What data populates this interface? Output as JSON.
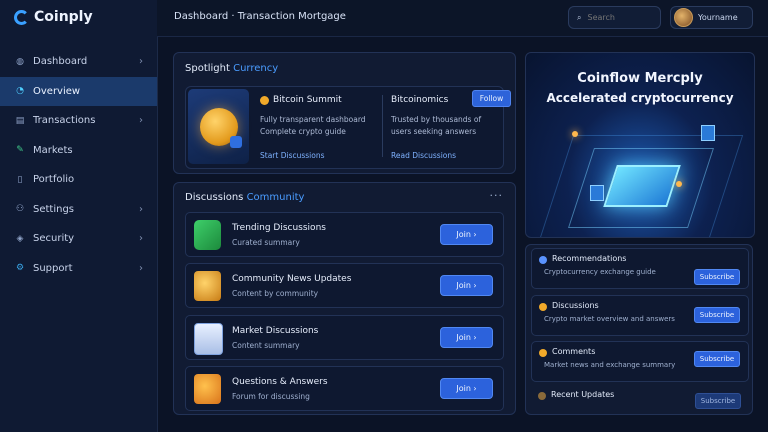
{
  "app": {
    "name": "Coinply"
  },
  "sidebar": {
    "items": [
      {
        "label": "Dashboard",
        "icon": "globe-icon",
        "active": false
      },
      {
        "label": "Overview",
        "icon": "pie-icon",
        "active": true
      },
      {
        "label": "Transactions",
        "icon": "list-icon",
        "active": false
      },
      {
        "label": "Markets",
        "icon": "pen-icon",
        "active": false
      },
      {
        "label": "Portfolio",
        "icon": "document-icon",
        "active": false
      },
      {
        "label": "Settings",
        "icon": "person-icon",
        "active": false
      },
      {
        "label": "Security",
        "icon": "shield-icon",
        "active": false
      },
      {
        "label": "Support",
        "icon": "gear-icon",
        "active": false
      }
    ]
  },
  "topbar": {
    "title": "Dashboard · Transaction Mortgage",
    "search_placeholder": "Search",
    "user_name": "Yourname"
  },
  "featured": {
    "title": "Spotlight",
    "title_accent": "Currency",
    "coin_name": "Bitcoin Summit",
    "line1": "Fully transparent dashboard",
    "line2": "Complete crypto guide",
    "link": "Start Discussions",
    "stat_title": "Bitcoinomics",
    "stat_line1": "Trusted by thousands of",
    "stat_line2": "users seeking answers",
    "stat_link": "Read Discussions",
    "button": "Follow"
  },
  "hero": {
    "line1": "Coinflow Mercply",
    "line2": "Accelerated cryptocurrency"
  },
  "discover": {
    "title": "Discussions",
    "title_accent": "Community",
    "more_label": "···",
    "rows": [
      {
        "title": "Trending Discussions",
        "sub": "Curated summary",
        "button": "Join ›",
        "icon": "green-icon"
      },
      {
        "title": "Community News Updates",
        "sub": "Content by community",
        "button": "Join ›",
        "icon": "gold-icon"
      },
      {
        "title": "Market Discussions",
        "sub": "Content summary",
        "button": "Join ›",
        "icon": "doc-icon"
      },
      {
        "title": "Questions & Answers",
        "sub": "Forum for discussing",
        "button": "Join ›",
        "icon": "orange-icon"
      }
    ]
  },
  "side_list": {
    "rows": [
      {
        "title": "Recommendations",
        "sub": "Cryptocurrency exchange guide",
        "button": "Subscribe",
        "dot": "#5a93ff"
      },
      {
        "title": "Discussions",
        "sub": "Crypto market overview and answers",
        "button": "Subscribe",
        "dot": "#f0a92a"
      },
      {
        "title": "Comments",
        "sub": "Market news and exchange summary",
        "button": "Subscribe",
        "dot": "#f0a92a"
      },
      {
        "title": "Recent Updates",
        "sub": "",
        "button": "Subscribe",
        "dot": "#8a6a3a"
      }
    ]
  }
}
